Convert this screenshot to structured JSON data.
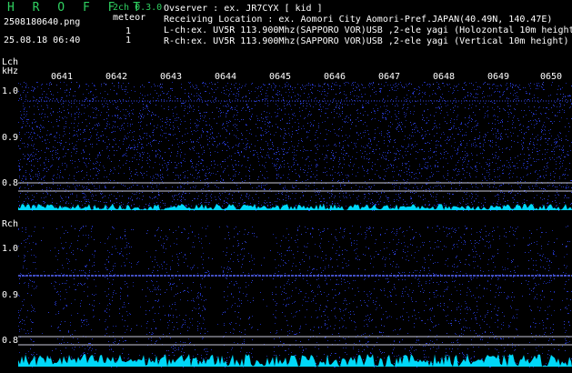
{
  "header": {
    "title": "H R O F F T",
    "version": "2ch 0.3.0",
    "filename": "2508180640.png",
    "meteor_label": "meteor",
    "datetime": "25.08.18 06:40",
    "lch_count": "1",
    "rch_count": "1",
    "observer": "Ovserver            : ex. JR7CYX [ kid ]",
    "location": "Receiving Location : ex. Aomori City Aomori-Pref.JAPAN(40.49N, 140.47E)",
    "lch_info": "L-ch:ex. UV5R 113.900Mhz(SAPPORO VOR)USB ,2-ele yagi (Holozontal 10m height",
    "rch_info": "R-ch:ex. UV5R 113.900Mhz(SAPPORO VOR)USB ,2-ele yagi (Vertical 10m height)"
  },
  "lch": {
    "label_ch": "Lch",
    "label_unit": "kHz",
    "y_labels": [
      "1.0",
      "0.9",
      "0.8"
    ]
  },
  "rch": {
    "label_ch": "Rch",
    "y_labels": [
      "1.0",
      "0.9",
      "0.8"
    ]
  },
  "time_ticks": [
    "0641",
    "0642",
    "0643",
    "0644",
    "0645",
    "0646",
    "0647",
    "0648",
    "0649",
    "0650"
  ],
  "colors": {
    "background": "#000000",
    "noise": "#1c2aa8",
    "trace": "#00e0ff",
    "title_green": "#2fd060",
    "line": "#ffffff"
  }
}
